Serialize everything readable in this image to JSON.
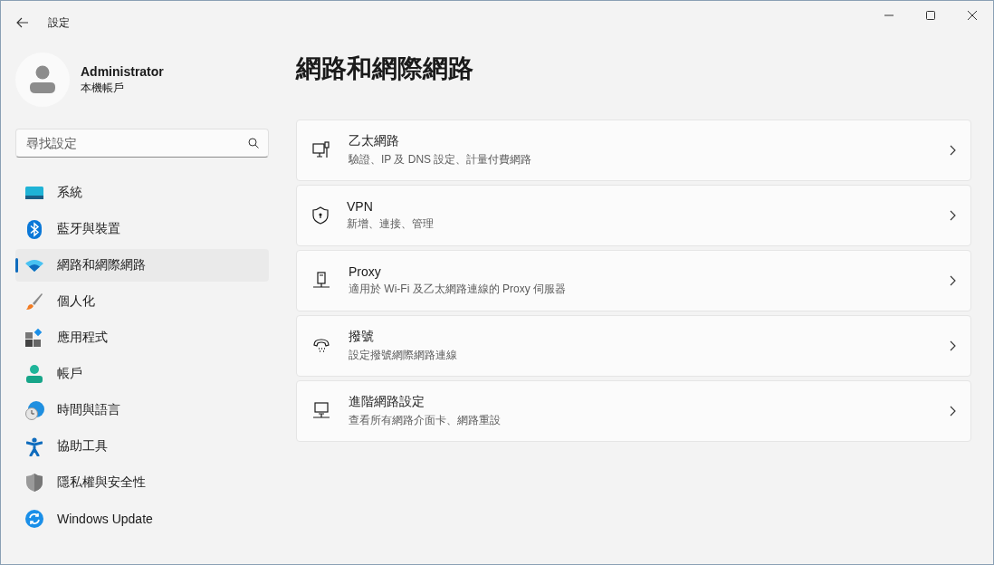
{
  "window": {
    "title": "設定"
  },
  "account": {
    "name": "Administrator",
    "type": "本機帳戶"
  },
  "search": {
    "placeholder": "尋找設定"
  },
  "sidebar": {
    "items": [
      {
        "kind": "display",
        "label": "系統",
        "selected": false
      },
      {
        "kind": "bluetooth",
        "label": "藍牙與裝置",
        "selected": false
      },
      {
        "kind": "wifi",
        "label": "網路和網際網路",
        "selected": true
      },
      {
        "kind": "brush",
        "label": "個人化",
        "selected": false
      },
      {
        "kind": "apps",
        "label": "應用程式",
        "selected": false
      },
      {
        "kind": "person",
        "label": "帳戶",
        "selected": false
      },
      {
        "kind": "globe",
        "label": "時間與語言",
        "selected": false
      },
      {
        "kind": "accessibility",
        "label": "協助工具",
        "selected": false
      },
      {
        "kind": "shield",
        "label": "隱私權與安全性",
        "selected": false
      },
      {
        "kind": "update",
        "label": "Windows Update",
        "selected": false
      }
    ]
  },
  "page": {
    "title": "網路和網際網路",
    "cards": [
      {
        "kind": "ethernet",
        "title": "乙太網路",
        "subtitle": "驗證、IP 及 DNS 設定、計量付費網路"
      },
      {
        "kind": "vpn",
        "title": "VPN",
        "subtitle": "新增、連接、管理"
      },
      {
        "kind": "proxy",
        "title": "Proxy",
        "subtitle": "適用於 Wi-Fi 及乙太網路連線的 Proxy 伺服器"
      },
      {
        "kind": "dialup",
        "title": "撥號",
        "subtitle": "設定撥號網際網路連線"
      },
      {
        "kind": "advanced",
        "title": "進階網路設定",
        "subtitle": "查看所有網路介面卡、網路重設"
      }
    ]
  }
}
